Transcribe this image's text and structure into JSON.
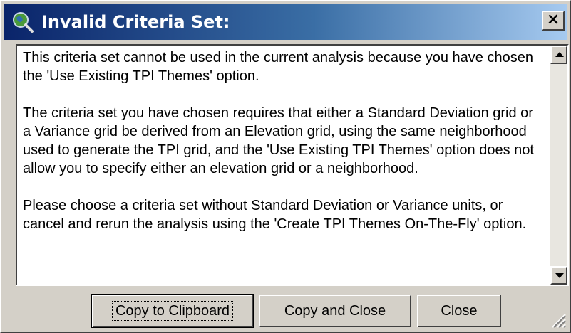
{
  "window": {
    "title": "Invalid Criteria Set:",
    "close_label": "×"
  },
  "message": {
    "paragraphs": [
      "This criteria set cannot be used in the current analysis because you have chosen the 'Use Existing TPI Themes' option.",
      "The criteria set you have chosen requires that either a Standard Deviation grid or a Variance grid be derived from an Elevation grid, using the same neighborhood used to generate the TPI grid, and the 'Use Existing TPI Themes' option does not allow you to specify either an elevation grid or a neighborhood.",
      "Please choose a criteria set without Standard Deviation or Variance units, or cancel and rerun the analysis using the 'Create TPI Themes On-The-Fly' option."
    ]
  },
  "buttons": {
    "copy_to_clipboard": "Copy to Clipboard",
    "copy_and_close": "Copy and Close",
    "close": "Close"
  },
  "icons": {
    "title": "globe-magnifier-icon",
    "close": "close-icon",
    "scroll_up": "arrow-up-icon",
    "scroll_down": "arrow-down-icon",
    "resize": "resize-grip-icon"
  },
  "colors": {
    "titlebar_start": "#0a246a",
    "titlebar_end": "#a6caf0",
    "face": "#d4d0c8"
  }
}
